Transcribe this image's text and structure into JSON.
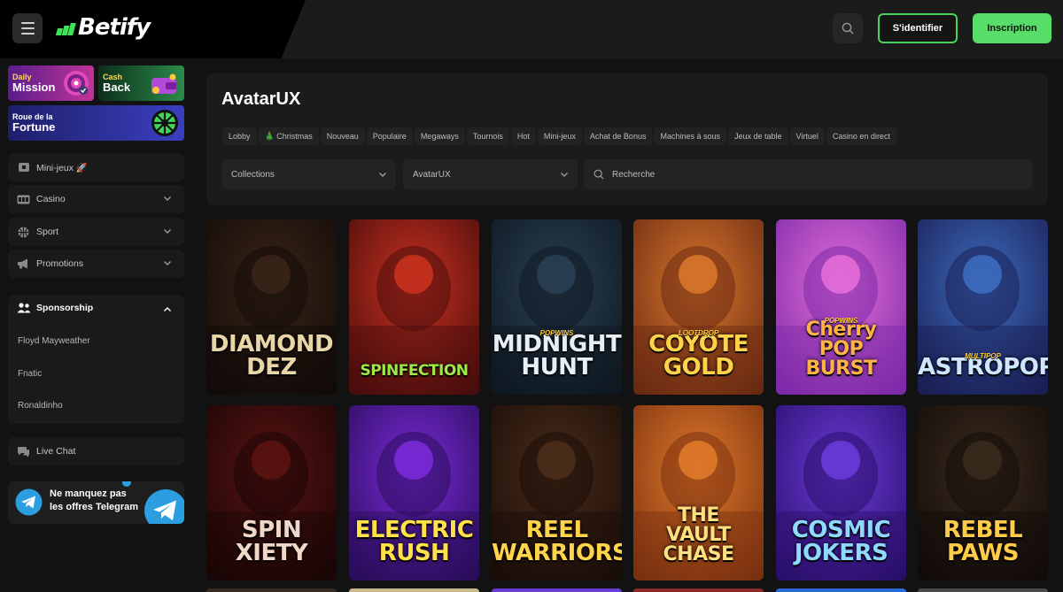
{
  "header": {
    "logo_text": "Betify",
    "login_label": "S'identifier",
    "signup_label": "Inscription",
    "accent": "#58dd6a"
  },
  "sidebar": {
    "promos": [
      {
        "small": "Daily",
        "big": "Mission"
      },
      {
        "small": "Cash",
        "big": "Back"
      },
      {
        "small": "Roue de la",
        "big": "Fortune"
      }
    ],
    "nav": [
      {
        "label": "Mini-jeux 🚀",
        "icon": "controller-icon"
      },
      {
        "label": "Casino",
        "icon": "slot-icon"
      },
      {
        "label": "Sport",
        "icon": "ball-icon"
      },
      {
        "label": "Promotions",
        "icon": "megaphone-icon"
      }
    ],
    "sponsorship": {
      "label": "Sponsorship",
      "items": [
        "Floyd Mayweather",
        "Fnatic",
        "Ronaldinho"
      ]
    },
    "live_chat": "Live Chat",
    "telegram": {
      "line1": "Ne manquez pas",
      "line2": "les offres Telegram"
    }
  },
  "main": {
    "title": "AvatarUX",
    "tabs": [
      "Lobby",
      "🎄 Christmas",
      "Nouveau",
      "Populaire",
      "Megaways",
      "Tournois",
      "Hot",
      "Mini-jeux",
      "Achat de Bonus",
      "Machines à sous",
      "Jeux de table",
      "Virtuel",
      "Casino en direct"
    ],
    "filters": {
      "collections": "Collections",
      "provider": "AvatarUX",
      "search_placeholder": "Recherche"
    }
  },
  "games": [
    {
      "title": [
        "DIAMOND",
        "DEZ"
      ],
      "tag": "",
      "bg1": "#3a2418",
      "bg2": "#120b08",
      "color": "#e8d6a8"
    },
    {
      "title": [
        "SPINFECTION"
      ],
      "tag": "",
      "bg1": "#c8311e",
      "bg2": "#4a0d0d",
      "color": "#9ee84a"
    },
    {
      "title": [
        "MIDNIGHT",
        "HUNT"
      ],
      "tag": "POPWINS",
      "bg1": "#2a3f52",
      "bg2": "#0e1822",
      "color": "#e8eef5"
    },
    {
      "title": [
        "COYOTE",
        "GOLD"
      ],
      "tag": "LOOTDROP",
      "bg1": "#d8762c",
      "bg2": "#6a2a12",
      "color": "#ffd24a"
    },
    {
      "title": [
        "Cherry",
        "POP",
        "BURST"
      ],
      "tag": "POPWINS",
      "bg1": "#e46ed8",
      "bg2": "#7c2aa8",
      "color": "#ffb347"
    },
    {
      "title": [
        "ASTROPOP"
      ],
      "tag": "MULTIPOP",
      "bg1": "#3c6bbd",
      "bg2": "#1b1f55",
      "color": "#cfe6ff"
    },
    {
      "title": [
        "SPIN",
        "XIETY"
      ],
      "tag": "",
      "bg1": "#5a1212",
      "bg2": "#1a0606",
      "color": "#f0d8c8"
    },
    {
      "title": [
        "ELECTRIC",
        "RUSH"
      ],
      "tag": "",
      "bg1": "#7a2ad8",
      "bg2": "#2a0d5a",
      "color": "#ffe14a"
    },
    {
      "title": [
        "REEL",
        "WARRIORS"
      ],
      "tag": "",
      "bg1": "#4a2c1a",
      "bg2": "#1a0d08",
      "color": "#ffd34a"
    },
    {
      "title": [
        "THE",
        "VAULT",
        "CHASE"
      ],
      "tag": "",
      "bg1": "#e07a2a",
      "bg2": "#7a3010",
      "color": "#ffdf80"
    },
    {
      "title": [
        "COSMIC",
        "JOKERS"
      ],
      "tag": "",
      "bg1": "#6a3ad8",
      "bg2": "#2a0f6a",
      "color": "#8fd8ff"
    },
    {
      "title": [
        "REBEL",
        "PAWS"
      ],
      "tag": "",
      "bg1": "#3a2a1e",
      "bg2": "#120c08",
      "color": "#ffcc4a"
    }
  ]
}
